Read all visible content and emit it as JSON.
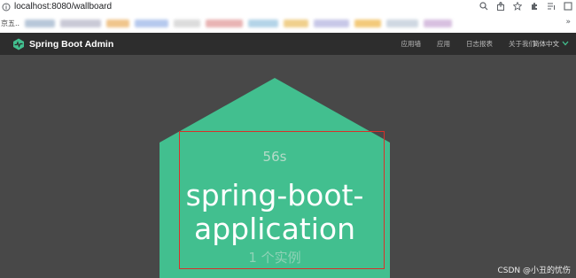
{
  "browser": {
    "url": "localhost:8080/wallboard",
    "bookmark_first": "京五..",
    "more_glyph": "»"
  },
  "nav": {
    "brand": "Spring Boot Admin",
    "items": [
      "应用墙",
      "应用",
      "日志报表",
      "关于我们"
    ],
    "language": "简体中文"
  },
  "tile": {
    "uptime": "56s",
    "app_name_line1": "spring-boot-",
    "app_name_line2": "application",
    "instances": "1 个实例",
    "color": "#42bf8f",
    "highlight_color": "#d9302a"
  },
  "watermark": "CSDN @小丑的忧伤"
}
